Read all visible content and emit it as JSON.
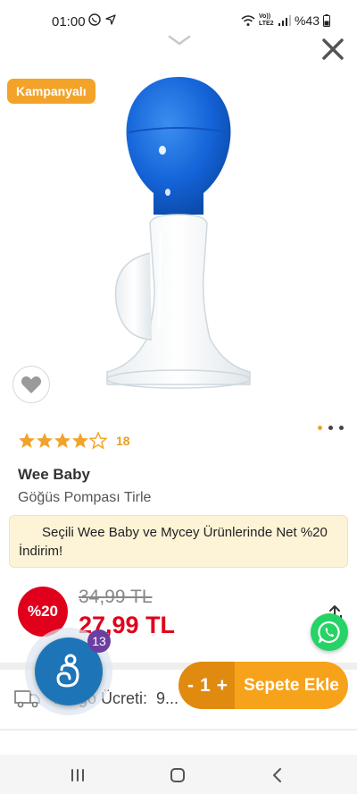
{
  "status_bar": {
    "time": "01:00",
    "network": "Vo)) LTE2",
    "battery": "%43"
  },
  "product": {
    "campaign_badge": "Kampanyalı",
    "rating_stars": 4,
    "rating_max": 5,
    "review_count": "18",
    "brand": "Wee Baby",
    "name": "Göğüs Pompası Tirle",
    "promo_text": "Seçili Wee Baby ve Mycey Ürünlerinde Net %20 İndirim!",
    "discount_badge": "%20",
    "old_price": "34,99 TL",
    "new_price": "27,99 TL",
    "image_count": 3,
    "active_image": 0
  },
  "shipping": {
    "label": "Kargo Ücreti:",
    "value": "9..."
  },
  "chat": {
    "badge_count": "13"
  },
  "cart": {
    "minus": "-",
    "quantity": "1",
    "plus": "+",
    "add_label": "Sepete Ekle"
  },
  "colors": {
    "accent": "#f7a21b",
    "accent_dark": "#e08a10",
    "discount_red": "#e0001b",
    "promo_bg": "#fdf3d6",
    "chat_blue": "#1d75b8"
  }
}
